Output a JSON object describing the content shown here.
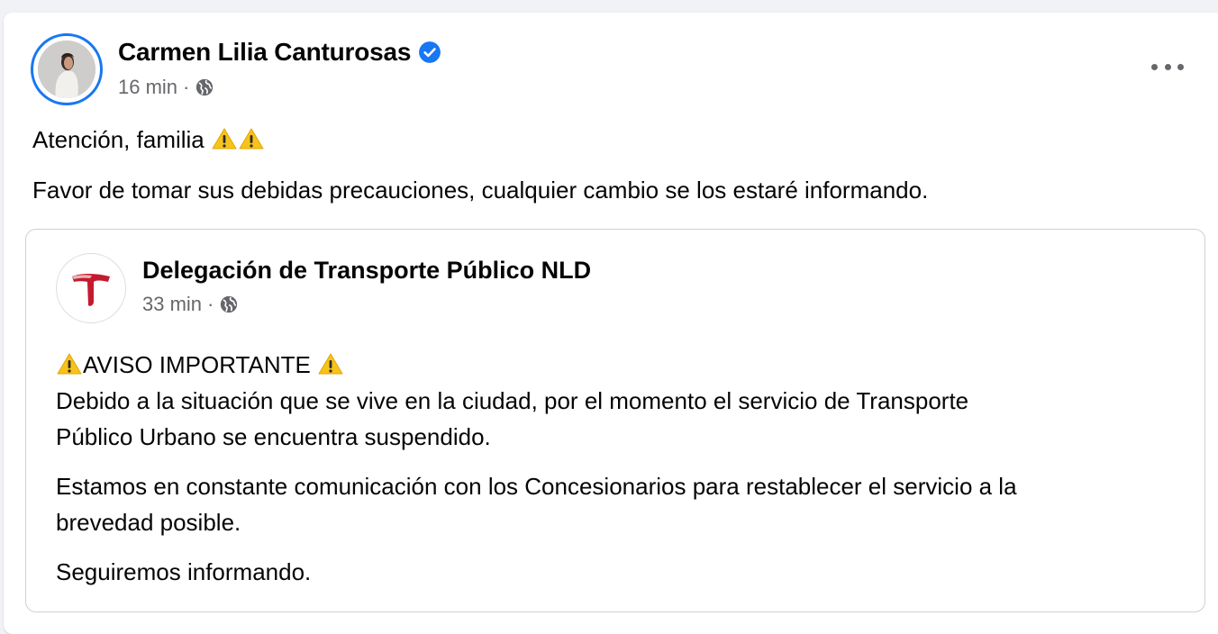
{
  "post": {
    "author": "Carmen Lilia Canturosas",
    "time": "16 min",
    "separator": "·",
    "privacy_icon": "globe-icon",
    "verified_icon": "verified-badge-icon",
    "more_icon": "more-options-icon",
    "text_line1": "Atención, familia",
    "text_line2": "Favor de tomar sus debidas precauciones, cualquier cambio se los estaré informando."
  },
  "shared": {
    "page_name": "Delegación de Transporte Público NLD",
    "time": "33 min",
    "separator": "·",
    "privacy_icon": "globe-icon",
    "heading": "AVISO IMPORTANTE",
    "paragraph1_line1": "Debido a la situación que se vive en la ciudad, por el momento el servicio de Transporte",
    "paragraph1_line2": "Público Urbano se encuentra suspendido.",
    "paragraph2_line1": "Estamos en constante comunicación con los Concesionarios para restablecer el servicio a la",
    "paragraph2_line2": "brevedad posible.",
    "paragraph3": "Seguiremos informando."
  },
  "colors": {
    "accent": "#1877f2",
    "secondary_text": "#65676b",
    "warning": "#f7c21a",
    "logo_red": "#c41a2e"
  }
}
